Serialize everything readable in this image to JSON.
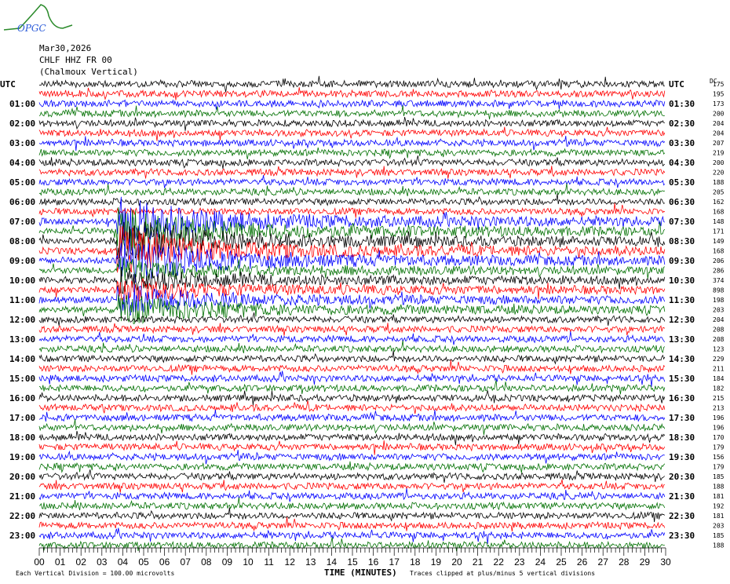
{
  "logo": {
    "text": "OPGC"
  },
  "header": {
    "date": "Mar30,2026",
    "station": "CHLF HHZ FR 00",
    "location": "(Chalmoux Vertical)"
  },
  "top_right_label": "DC",
  "colors": {
    "traces": [
      "#000000",
      "#ff0000",
      "#0000ff",
      "#007000"
    ]
  },
  "chart_data": {
    "type": "line",
    "title": "CHLF HHZ FR 00 (Chalmoux Vertical) Mar30,2026",
    "xlabel": "TIME (MINUTES)",
    "xlim": [
      0,
      30
    ],
    "x_ticks": [
      "00",
      "01",
      "02",
      "03",
      "04",
      "05",
      "06",
      "07",
      "08",
      "09",
      "10",
      "11",
      "12",
      "13",
      "14",
      "15",
      "16",
      "17",
      "18",
      "19",
      "20",
      "21",
      "22",
      "23",
      "24",
      "25",
      "26",
      "27",
      "28",
      "29",
      "30"
    ],
    "left_labels": [
      "UTC",
      "01:00",
      "02:00",
      "03:00",
      "04:00",
      "05:00",
      "06:00",
      "07:00",
      "08:00",
      "09:00",
      "10:00",
      "11:00",
      "12:00",
      "13:00",
      "14:00",
      "15:00",
      "16:00",
      "17:00",
      "18:00",
      "19:00",
      "20:00",
      "21:00",
      "22:00",
      "23:00"
    ],
    "right_labels": [
      "UTC",
      "01:30",
      "02:30",
      "03:30",
      "04:30",
      "05:30",
      "06:30",
      "07:30",
      "08:30",
      "09:30",
      "10:30",
      "11:30",
      "12:30",
      "13:30",
      "14:30",
      "15:30",
      "16:30",
      "17:30",
      "18:30",
      "19:30",
      "20:30",
      "21:30",
      "22:30",
      "23:30"
    ],
    "trace_dc_values": [
      175,
      195,
      173,
      200,
      204,
      204,
      207,
      219,
      200,
      220,
      188,
      205,
      162,
      168,
      148,
      171,
      149,
      168,
      206,
      286,
      374,
      898,
      198,
      203,
      204,
      208,
      208,
      123,
      229,
      211,
      184,
      182,
      215,
      213,
      196,
      196,
      170,
      179,
      156,
      179,
      185,
      188,
      181,
      192,
      181,
      203,
      185,
      188
    ],
    "trace_minutes": 30,
    "event": {
      "start_trace_label": "07:30",
      "start_minute": 3.7
    },
    "footer_left": "Each Vertical Division =  100.00 microvolts",
    "footer_right": "Traces clipped at plus/minus 5 vertical divisions"
  }
}
